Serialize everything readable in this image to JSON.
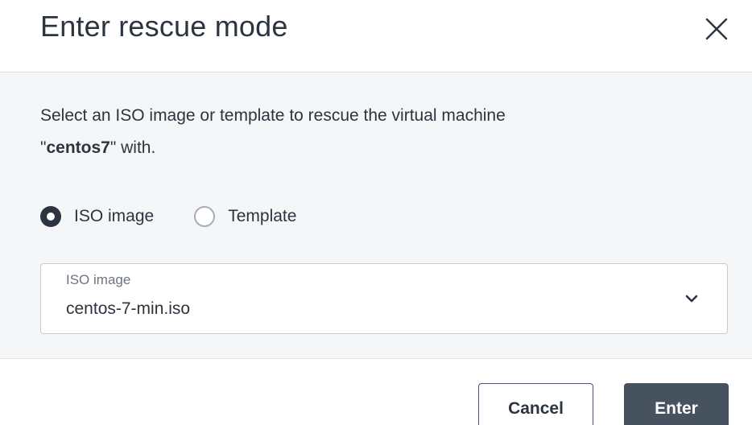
{
  "dialog": {
    "title": "Enter rescue mode",
    "close_icon": "close-icon"
  },
  "body": {
    "description_prefix": "Select an ISO image or template to rescue the virtual machine",
    "description_quote_open": "\"",
    "vm_name": "centos7",
    "description_suffix": "\" with.",
    "source_options": [
      {
        "label": "ISO image",
        "selected": true
      },
      {
        "label": "Template",
        "selected": false
      }
    ],
    "iso_select": {
      "label": "ISO image",
      "value": "centos-7-min.iso",
      "icon": "chevron-down-icon"
    }
  },
  "footer": {
    "cancel_label": "Cancel",
    "enter_label": "Enter"
  },
  "colors": {
    "text": "#2c3440",
    "body_bg": "#f5f6f7",
    "primary_button": "#46535f",
    "border": "#c6cbd1"
  }
}
